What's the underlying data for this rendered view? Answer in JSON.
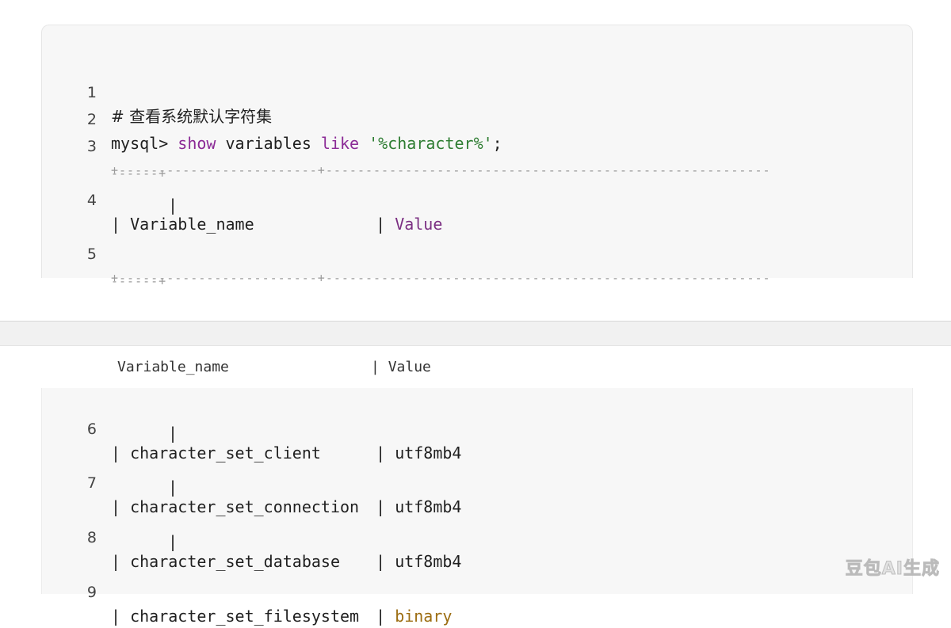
{
  "code": {
    "comment": "# 查看系统默认字符集",
    "prompt": "mysql> ",
    "kw_show": "show",
    "kw_variables": " variables ",
    "kw_like": "like",
    "string_literal": " '%character%'",
    "terminator": ";",
    "divider_line": "+-------------------------+--------------------------------------------------------",
    "divider_cont": "------+",
    "pipe": "|",
    "continuation_pipe": "|",
    "header_name": "Variable_name",
    "header_value": "Value",
    "rows": [
      {
        "name": "character_set_client",
        "value": "utf8mb4"
      },
      {
        "name": "character_set_connection",
        "value": "utf8mb4"
      },
      {
        "name": "character_set_database",
        "value": "utf8mb4"
      },
      {
        "name": "character_set_filesystem",
        "value": "binary"
      }
    ]
  },
  "line_numbers": [
    "1",
    "2",
    "3",
    "4",
    "5",
    "6",
    "7",
    "8",
    "9"
  ],
  "sticky_header": {
    "name": "Variable_name",
    "pipe": "|",
    "value": "Value"
  },
  "watermark": "豆包AI生成",
  "colors": {
    "keyword": "#8b2a96",
    "string": "#2e7d32",
    "value_purple": "#7b2f82",
    "value_amber": "#9c6d12",
    "panel_bg": "#f7f7f7"
  }
}
